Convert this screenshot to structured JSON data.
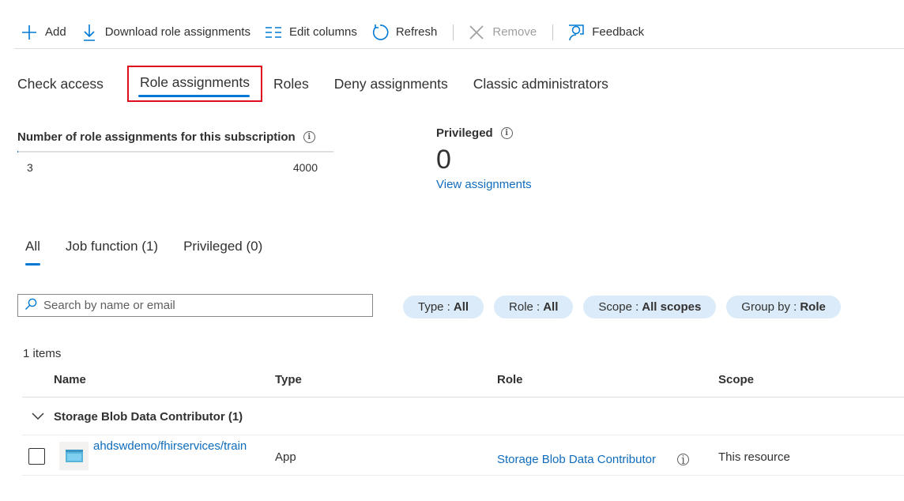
{
  "toolbar": {
    "add": "Add",
    "download": "Download role assignments",
    "edit_columns": "Edit columns",
    "refresh": "Refresh",
    "remove": "Remove",
    "feedback": "Feedback"
  },
  "tabs": [
    "Check access",
    "Role assignments",
    "Roles",
    "Deny assignments",
    "Classic administrators"
  ],
  "active_tab": "Role assignments",
  "stats": {
    "count_title": "Number of role assignments for this subscription",
    "current": "3",
    "max": "4000",
    "usage_fraction": 0.00075,
    "privileged_title": "Privileged",
    "privileged_count": "0",
    "view_link": "View assignments"
  },
  "subtabs": [
    "All",
    "Job function (1)",
    "Privileged (0)"
  ],
  "search": {
    "placeholder": "Search by name or email"
  },
  "filters": [
    {
      "key": "Type : ",
      "value": "All"
    },
    {
      "key": "Role : ",
      "value": "All"
    },
    {
      "key": "Scope : ",
      "value": "All scopes"
    },
    {
      "key": "Group by : ",
      "value": "Role"
    }
  ],
  "table": {
    "items_count": "1 items",
    "headers": {
      "name": "Name",
      "type": "Type",
      "role": "Role",
      "scope": "Scope"
    },
    "group_label": "Storage Blob Data Contributor (1)",
    "rows": [
      {
        "name": "ahdswdemo/fhirservices/train",
        "type": "App",
        "role": "Storage Blob Data Contributor",
        "scope": "This resource"
      }
    ]
  },
  "colors": {
    "accent": "#0078d4",
    "highlight_box": "#e00b1c",
    "pill_bg": "#dbebf9",
    "link": "#0f6cbd"
  }
}
